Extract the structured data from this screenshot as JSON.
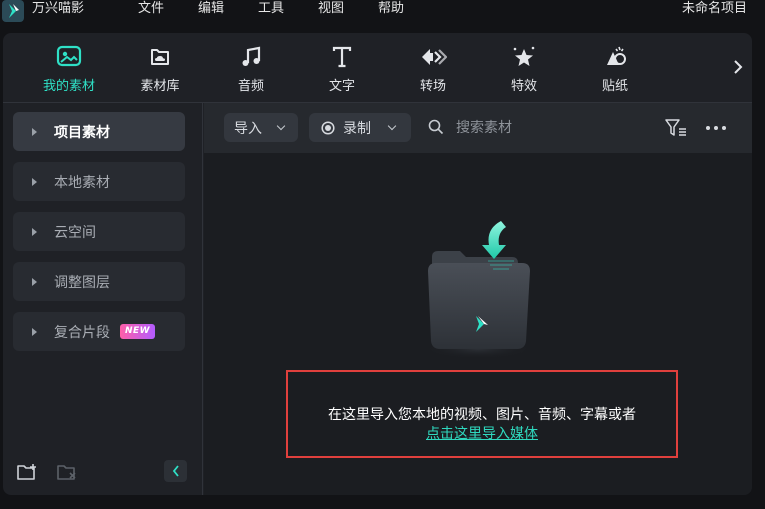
{
  "app": {
    "name": "万兴喵影",
    "logo_icon": "filmora-logo-icon",
    "menu": [
      "文件",
      "编辑",
      "工具",
      "视图",
      "帮助"
    ],
    "project_title": "未命名项目"
  },
  "tabs": [
    {
      "label": "我的素材",
      "icon": "my-media-icon",
      "active": true
    },
    {
      "label": "素材库",
      "icon": "cloud-library-icon",
      "active": false
    },
    {
      "label": "音频",
      "icon": "music-note-icon",
      "active": false
    },
    {
      "label": "文字",
      "icon": "text-t-icon",
      "active": false
    },
    {
      "label": "转场",
      "icon": "transition-icon",
      "active": false
    },
    {
      "label": "特效",
      "icon": "effects-star-icon",
      "active": false
    },
    {
      "label": "贴纸",
      "icon": "sticker-icon",
      "active": false
    }
  ],
  "sidebar": {
    "items": [
      {
        "label": "项目素材",
        "active": true
      },
      {
        "label": "本地素材",
        "active": false
      },
      {
        "label": "云空间",
        "active": false
      },
      {
        "label": "调整图层",
        "active": false
      },
      {
        "label": "复合片段",
        "active": false,
        "badge": "NEW"
      }
    ]
  },
  "toolbar": {
    "import_label": "导入",
    "record_label": "录制",
    "search_placeholder": "搜索素材"
  },
  "empty_state": {
    "message": "在这里导入您本地的视频、图片、音频、字幕或者",
    "link_text": "点击这里导入媒体"
  },
  "colors": {
    "accent": "#2fe0c6",
    "highlight_border": "#e0403d",
    "panel_bg": "#1f2126",
    "new_badge": "#ff5fa8"
  }
}
